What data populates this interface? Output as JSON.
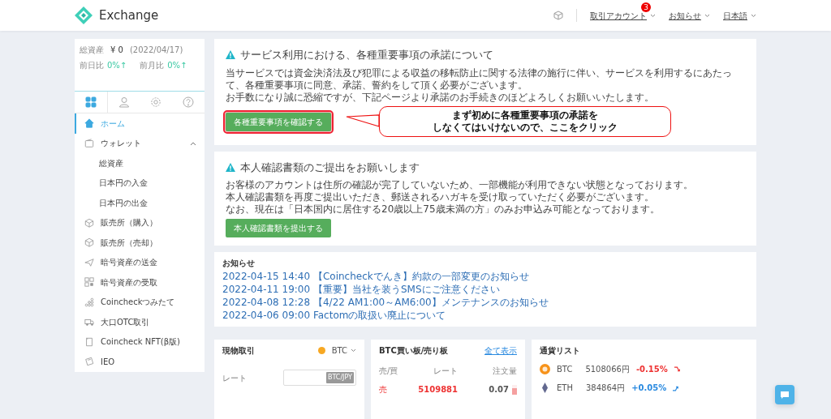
{
  "header": {
    "logo_text": "Exchange",
    "nav": [
      {
        "label": "取引アカウント",
        "badge": "3"
      },
      {
        "label": "お知らせ"
      },
      {
        "label": "日本語"
      }
    ]
  },
  "sidebar": {
    "balance": {
      "label": "総資産",
      "value": "¥ 0",
      "date": "(2022/04/17)",
      "day_label": "前日比",
      "day_value": "0%↑",
      "month_label": "前月比",
      "month_value": "0%↑"
    },
    "tabs": [
      {
        "selected": true
      },
      {
        "selected": false
      },
      {
        "selected": false
      },
      {
        "selected": false
      }
    ],
    "items": [
      {
        "label": "ホーム",
        "selected": true
      },
      {
        "label": "ウォレット",
        "selected": false,
        "expanded": true,
        "children": [
          {
            "label": "総資産"
          },
          {
            "label": "日本円の入金"
          },
          {
            "label": "日本円の出金"
          }
        ]
      },
      {
        "label": "販売所（購入）",
        "selected": false
      },
      {
        "label": "販売所（売却）",
        "selected": false
      },
      {
        "label": "暗号資産の送金",
        "selected": false
      },
      {
        "label": "暗号資産の受取",
        "selected": false
      },
      {
        "label": "Coincheckつみたて",
        "selected": false
      },
      {
        "label": "大口OTC取引",
        "selected": false
      },
      {
        "label": "Coincheck NFT(β版)",
        "selected": false
      },
      {
        "label": "IEO",
        "selected": false
      }
    ]
  },
  "notices": [
    {
      "title": "サービス利用における、各種重要事項の承諾について",
      "paragraphs": [
        "当サービスでは資金決済法及び犯罪による収益の移転防止に関する法律の施行に伴い、サービスを利用するにあたって、各種重要事項に同意、承諾、誓約をして頂く必要がございます。",
        "お手数になり誠に恐縮ですが、下記ページより承諾のお手続きのほどよろしくお願いいたします。"
      ],
      "button": "各種重要事項を確認する",
      "highlighted": true
    },
    {
      "title": "本人確認書類のご提出をお願いします",
      "paragraphs": [
        "お客様のアカウントは住所の確認が完了していないため、一部機能が利用できない状態となっております。",
        "本人確認書類を再度ご提出いただき、郵送されるハガキを受け取っていただく必要がございます。",
        "なお、現在は「日本国内に居住する20歳以上75歳未満の方」のみお申込み可能となっております。"
      ],
      "button": "本人確認書類を提出する",
      "highlighted": false
    }
  ],
  "annotation": {
    "lines": [
      "まず初めに各種重要事項の承諾を",
      "しなくてはいけないので、ここをクリック"
    ]
  },
  "news": {
    "title": "お知らせ",
    "items": [
      "2022-04-15 14:40 【Coincheckでんき】約款の一部変更のお知らせ",
      "2022-04-11 19:00 【重要】当社を装うSMSにご注意ください",
      "2022-04-08 12:28 【4/22 AM1:00～AM6:00】メンテナンスのお知らせ",
      "2022-04-06 09:00 Factomの取扱い廃止について"
    ]
  },
  "spot": {
    "title": "現物取引",
    "coin": "BTC",
    "rate_label": "レート",
    "rate_unit": "BTC/JPY"
  },
  "orderbook": {
    "title": "BTC買い板/売り板",
    "link": "全て表示",
    "columns": [
      "売/買",
      "レート",
      "注文量"
    ],
    "rows": [
      {
        "side": "売",
        "rate": "5109881",
        "amount": "0.07",
        "level": 0.6
      }
    ]
  },
  "currencies": {
    "title": "通貨リスト",
    "items": [
      {
        "symbol": "BTC",
        "price": "5108066円",
        "change": "-0.15%",
        "rising": false
      },
      {
        "symbol": "ETH",
        "price": "384864円",
        "change": "+0.05%",
        "rising": true
      }
    ]
  }
}
